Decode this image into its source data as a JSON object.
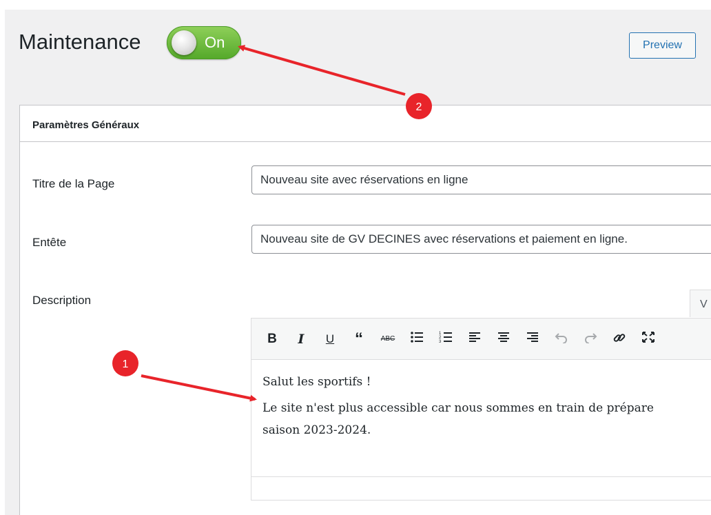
{
  "header": {
    "title": "Maintenance",
    "toggle": {
      "label": "On",
      "state": "on",
      "color": "#5cb330"
    },
    "preview_label": "Preview"
  },
  "panel": {
    "title": "Paramètres Généraux",
    "fields": [
      {
        "label": "Titre de la Page",
        "value": "Nouveau site avec réservations en ligne"
      },
      {
        "label": "Entête",
        "value": "Nouveau site de GV DECINES avec réservations et paiement en ligne."
      }
    ],
    "description": {
      "label": "Description",
      "tab_label": "V",
      "toolbar": [
        "bold",
        "italic",
        "underline",
        "blockquote",
        "strikethrough",
        "bullet-list",
        "numbered-list",
        "align-left",
        "align-center",
        "align-right",
        "undo",
        "redo",
        "link",
        "fullscreen"
      ],
      "paragraphs": [
        "Salut les sportifs !",
        "Le site n'est plus accessible car nous sommes en train de prépare",
        "saison 2023-2024."
      ]
    }
  },
  "annotations": [
    {
      "number": "1",
      "color": "#e8242a"
    },
    {
      "number": "2",
      "color": "#e8242a"
    }
  ]
}
